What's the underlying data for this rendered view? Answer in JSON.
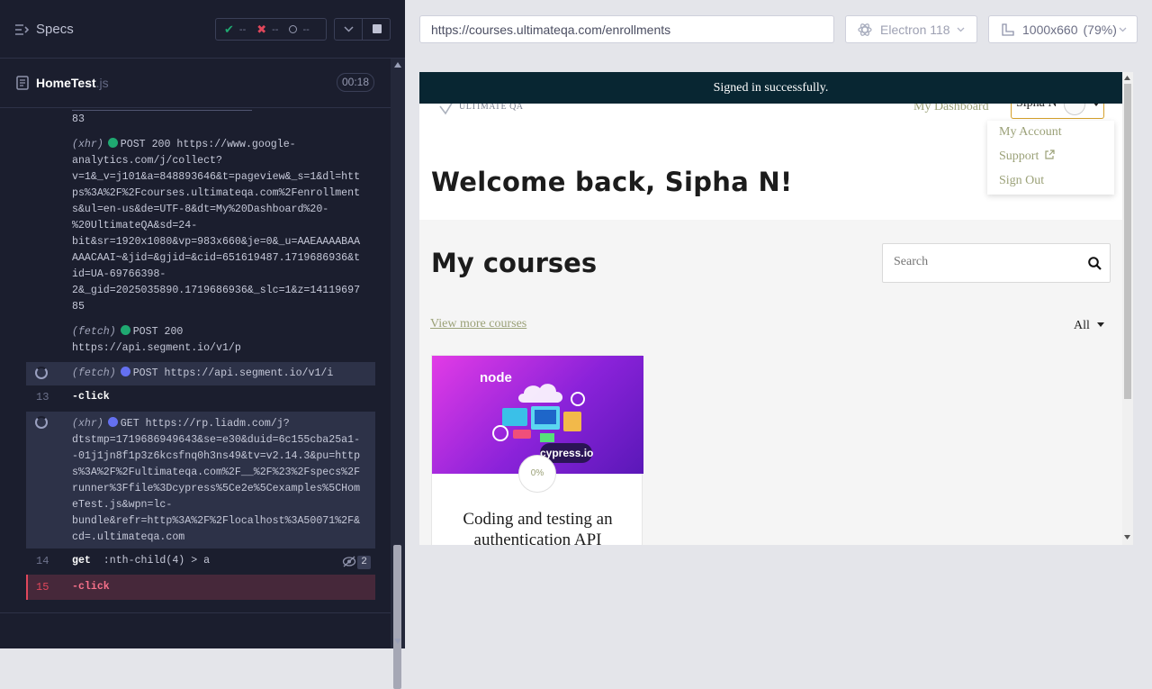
{
  "runner": {
    "specs_label": "Specs",
    "stats": {
      "passed": "--",
      "failed": "--",
      "pending": "--"
    },
    "file": {
      "name": "HomeTest",
      "ext": ".js",
      "timer": "00:18"
    },
    "log": {
      "line_83": "83",
      "xhr1": {
        "type": "(xhr)",
        "method": "POST 200 https://www.google-",
        "lines": [
          "analytics.com/j/collect?",
          "v=1&_v=j101&a=848893646&t=pageview&_s=1&dl=htt",
          "ps%3A%2F%2Fcourses.ultimateqa.com%2Fenrollment",
          "s&ul=en-us&de=UTF-8&dt=My%20Dashboard%20-",
          "%20UltimateQA&sd=24-",
          "bit&sr=1920x1080&vp=983x660&je=0&_u=AAEAAAABAA",
          "AAACAAI~&jid=&gjid=&cid=651619487.1719686936&t",
          "id=UA-69766398-",
          "2&_gid=2025035890.1719686936&_slc=1&z=14119697",
          "85"
        ]
      },
      "fetch1": {
        "type": "(fetch)",
        "method": "POST 200",
        "line2": "https://api.segment.io/v1/p"
      },
      "fetch2": {
        "type": "(fetch)",
        "method": "POST https://api.segment.io/v1/i"
      },
      "cmd13": {
        "num": "13",
        "cmd": "-click"
      },
      "xhr2": {
        "type": "(xhr)",
        "method": "GET https://rp.liadm.com/j?",
        "lines": [
          "dtstmp=1719686949643&se=e30&duid=6c155cba25a1-",
          "-01j1jn8f1p3z6kcsfnq0h3ns49&tv=v2.14.3&pu=http",
          "s%3A%2F%2Fultimateqa.com%2F__%2F%23%2Fspecs%2F",
          "runner%3Ffile%3Dcypress%5Ce2e%5Cexamples%5CHom",
          "eTest.js&wpn=lc-",
          "bundle&refr=http%3A%2F%2Flocalhost%3A50071%2F&",
          "cd=.ultimateqa.com"
        ]
      },
      "cmd14": {
        "num": "14",
        "cmd": "get",
        "selector": ":nth-child(4) > a",
        "badge": "2"
      },
      "cmd15": {
        "num": "15",
        "cmd": "-click"
      }
    }
  },
  "toolbar": {
    "url": "https://courses.ultimateqa.com/enrollments",
    "browser": "Electron 118",
    "viewport": "1000x660",
    "zoom": "(79%)"
  },
  "app": {
    "banner": "Signed in successfully.",
    "logo_text": "ULTIMATE QA",
    "nav_dashboard": "My Dashboard",
    "user_name": "Sipha N",
    "menu": [
      "My Account",
      "Support",
      "Sign Out"
    ],
    "welcome": "Welcome back, Sipha N!",
    "my_courses": "My courses",
    "search_placeholder": "Search",
    "view_more": "View more courses",
    "filter": "All",
    "course": {
      "title1": "Coding and testing an",
      "title2": "authentication API",
      "progress": "0%",
      "thumb_top": "node",
      "thumb_bottom": "cypress.io"
    }
  },
  "colors": {
    "accent_green": "#1fa971",
    "accent_blue": "#6470f0",
    "banner": "#082632",
    "link": "#9ba178"
  }
}
